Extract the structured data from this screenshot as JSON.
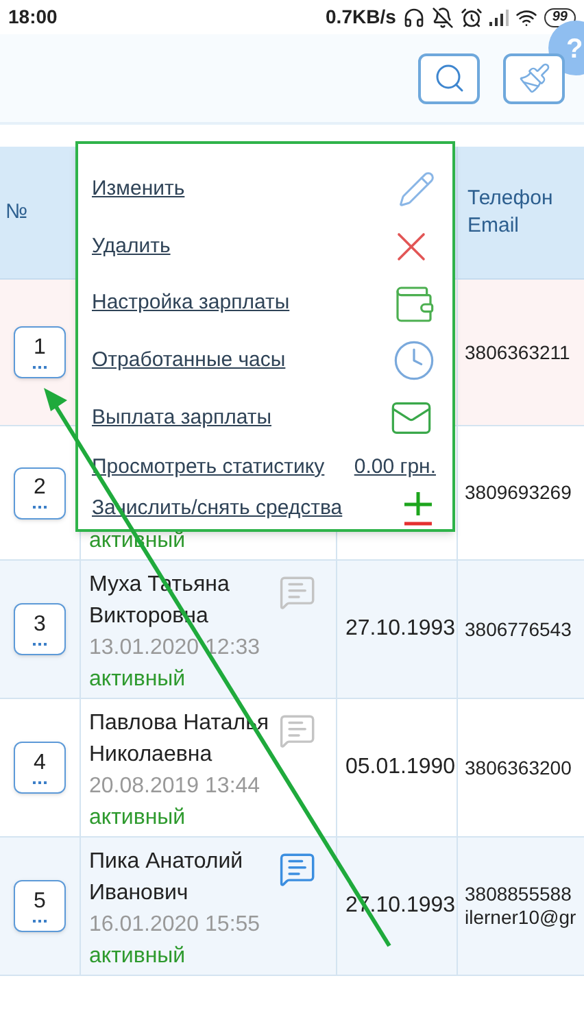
{
  "status_bar": {
    "time": "18:00",
    "speed": "0.7KB/s",
    "battery": "99"
  },
  "toolbar": {
    "help": "?"
  },
  "table": {
    "columns": {
      "number": "№",
      "phone": "Телефон",
      "email": "Email"
    },
    "rows": [
      {
        "number": "1",
        "selected": true,
        "phone": "3806363211"
      },
      {
        "number": "2",
        "selected": false,
        "status": "активный",
        "phone": "3809693269"
      },
      {
        "number": "3",
        "selected": false,
        "name": "Муха Татьяна Викторовна",
        "has_comment": false,
        "timestamp": "13.01.2020 12:33",
        "status": "активный",
        "date": "27.10.1993",
        "phone": "3806776543"
      },
      {
        "number": "4",
        "selected": false,
        "name": "Павлова Наталья Николаевна",
        "has_comment": false,
        "timestamp": "20.08.2019 13:44",
        "status": "активный",
        "date": "05.01.1990",
        "phone": "3806363200"
      },
      {
        "number": "5",
        "selected": false,
        "name": "Пика Анатолий Иванович",
        "has_comment": true,
        "timestamp": "16.01.2020 15:55",
        "status": "активный",
        "date": "27.10.1993",
        "phone": "3808855588",
        "email": "ilerner10@gr"
      }
    ]
  },
  "context_menu": {
    "items": [
      {
        "kind": "edit",
        "label": "Изменить"
      },
      {
        "kind": "delete",
        "label": "Удалить"
      },
      {
        "kind": "salary",
        "label": "Настройка зарплаты"
      },
      {
        "kind": "hours",
        "label": "Отработанные часы"
      },
      {
        "kind": "payout",
        "label": "Выплата зарплаты"
      },
      {
        "kind": "stats",
        "label": "Просмотреть статистику",
        "amount": "0.00 грн."
      },
      {
        "kind": "funds",
        "label": "Зачислить/снять средства"
      }
    ]
  }
}
